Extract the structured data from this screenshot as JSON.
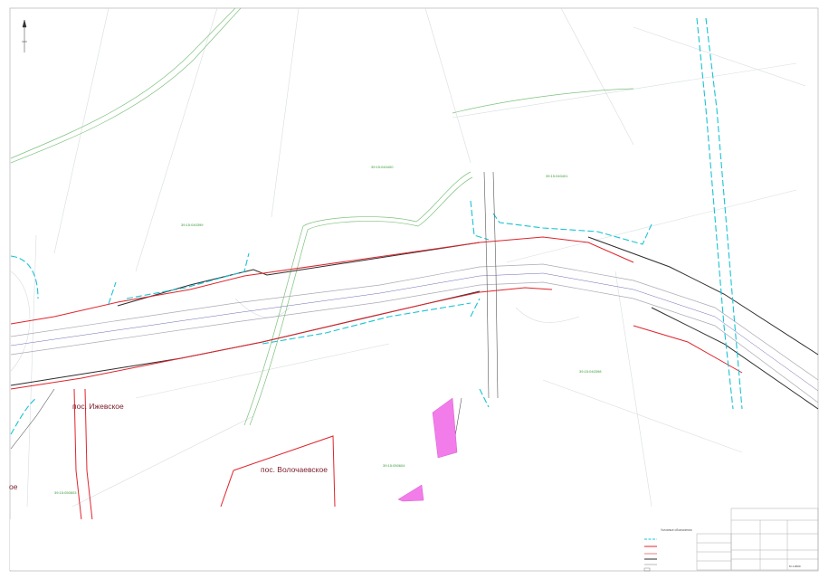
{
  "settlements": [
    {
      "id": "izhevskoe",
      "label": "пос. Ижевское"
    },
    {
      "id": "volochaevskoe",
      "label": "пос. Волочаевское"
    },
    {
      "id": "cut-off",
      "label": "ое"
    }
  ],
  "cadastral_labels": [
    {
      "id": "q1",
      "label": "39:15:040400"
    },
    {
      "id": "q2",
      "label": "39:15:040401"
    },
    {
      "id": "q3",
      "label": "39:15:040399"
    },
    {
      "id": "q4",
      "label": "39:15:040398"
    },
    {
      "id": "q5",
      "label": "39:15:050604"
    },
    {
      "id": "q6",
      "label": "39:15:050603"
    }
  ],
  "legend": {
    "heading": "Условные обозначения"
  },
  "title_block": {
    "scale_label": "М 1:2000"
  },
  "colors": {
    "cyan_boundary": "#19c3d6",
    "red_line": "#e0242c",
    "road_black": "#2d2d2d",
    "road_grey": "#a9a9b4",
    "green_lines": "#7ec27e",
    "magenta_parcel": "#f27ce9",
    "settlement_text": "#7a1c2a"
  }
}
